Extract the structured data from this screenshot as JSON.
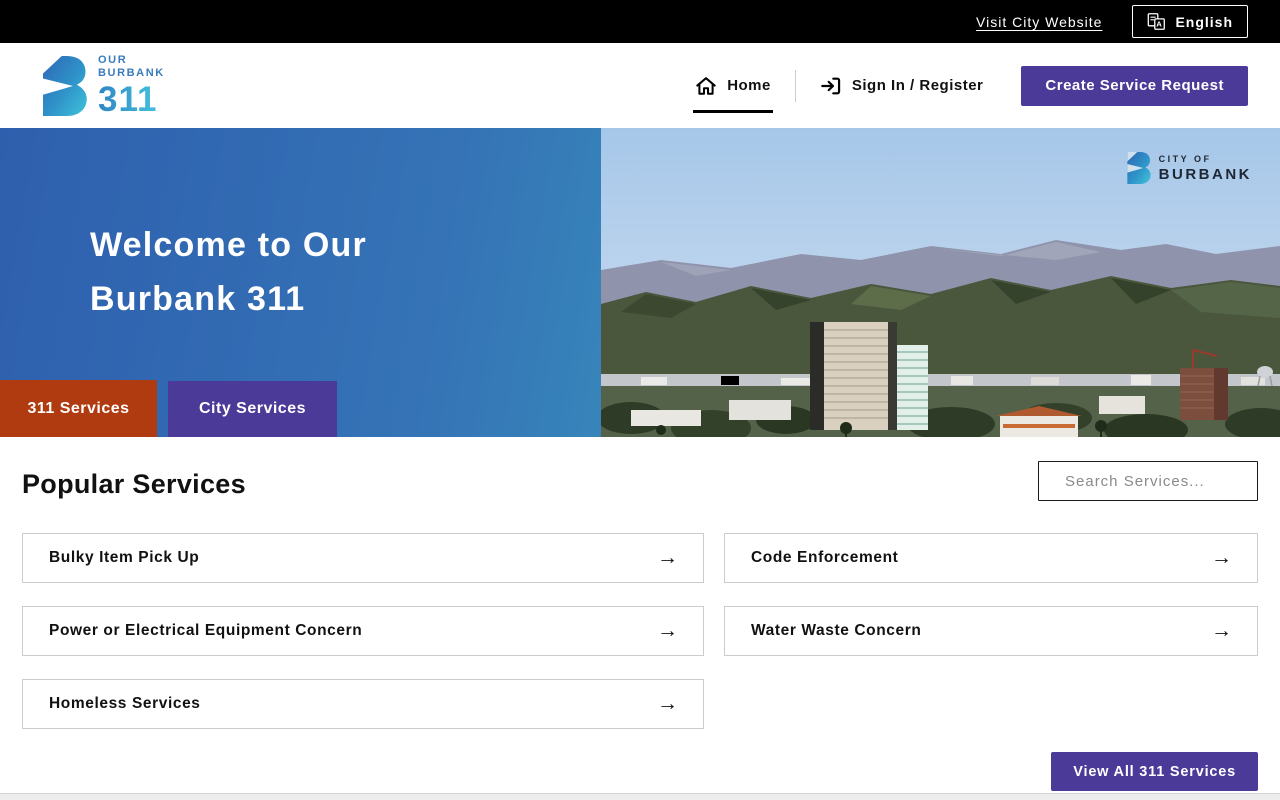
{
  "topbar": {
    "visit_city_website": "Visit City Website",
    "english": "English"
  },
  "header": {
    "logo": {
      "line1": "OUR",
      "line2": "BURBANK",
      "number": "311"
    },
    "nav_home": "Home",
    "nav_sign_in": "Sign In / Register",
    "create_service_request": "Create Service Request"
  },
  "hero": {
    "title_line1": "Welcome to Our",
    "title_line2": "Burbank 311",
    "city_badge": {
      "line1": "CITY OF",
      "line2": "BURBANK"
    },
    "tabs": [
      {
        "label": "311 Services",
        "active": true
      },
      {
        "label": "City Services",
        "active": false
      }
    ]
  },
  "popular_services": {
    "heading": "Popular Services",
    "search_placeholder": "Search Services...",
    "cards": [
      {
        "label": "Bulky Item Pick Up"
      },
      {
        "label": "Code Enforcement"
      },
      {
        "label": "Power or Electrical Equipment Concern"
      },
      {
        "label": "Water Waste Concern"
      },
      {
        "label": "Homeless Services"
      }
    ],
    "view_all": "View All 311 Services"
  },
  "icons": {
    "arrow_right": "→",
    "home": "house-icon",
    "sign_in": "login-arrow-icon",
    "language": "translate-document-icon"
  },
  "colors": {
    "purple": "#4B3A97",
    "rust": "#B13B10",
    "hero_blue": "#2E5FAE",
    "hero_teal": "#3EC4C8",
    "topbar_black": "#000000"
  }
}
